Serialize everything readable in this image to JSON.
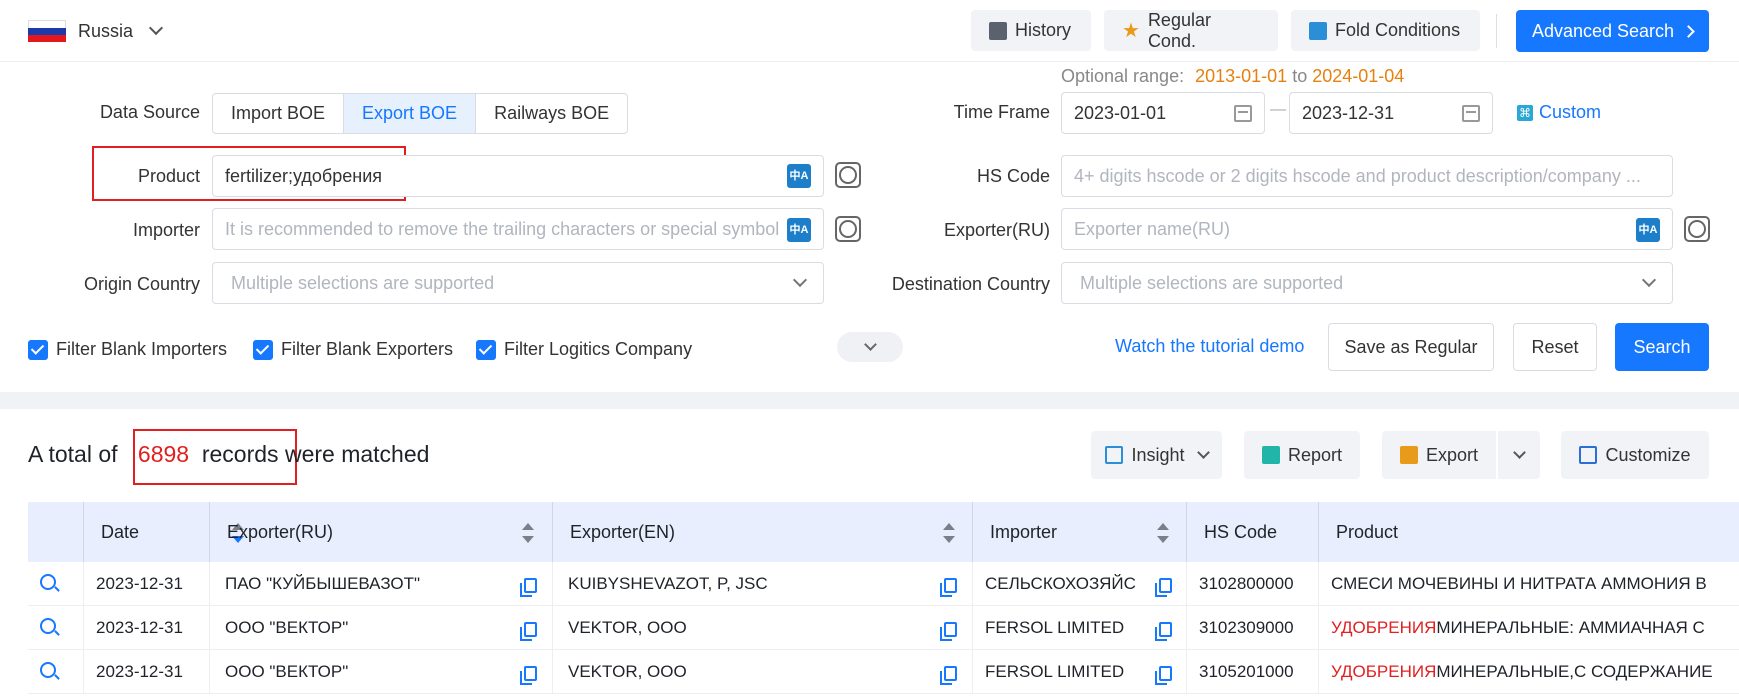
{
  "topbar": {
    "country": "Russia",
    "flag_colors": [
      "#ffffff",
      "#1c3aa9",
      "#e4181c"
    ],
    "history": "History",
    "regular": "Regular Cond.",
    "fold": "Fold Conditions",
    "advanced": "Advanced Search"
  },
  "form": {
    "data_source_label": "Data Source",
    "data_sources": [
      "Import BOE",
      "Export BOE",
      "Railways BOE"
    ],
    "active_source": "Export BOE",
    "optional_prefix": "Optional range:",
    "optional_from": "2013-01-01",
    "optional_to_word": "to",
    "optional_to": "2024-01-04",
    "time_frame_label": "Time Frame",
    "date_from": "2023-01-01",
    "date_to": "2023-12-31",
    "date_dash": "—",
    "custom": "Custom",
    "product_label": "Product",
    "product_value": "fertilizer;удобрения",
    "hs_label": "HS Code",
    "hs_placeholder": "4+ digits hscode or 2 digits hscode and product description/company ...",
    "importer_label": "Importer",
    "importer_placeholder": "It is recommended to remove the trailing characters or special symbols",
    "exporter_label": "Exporter(RU)",
    "exporter_placeholder": "Exporter name(RU)",
    "origin_label": "Origin Country",
    "origin_placeholder": "Multiple selections are supported",
    "dest_label": "Destination Country",
    "dest_placeholder": "Multiple selections are supported",
    "translate_glyph": "中A",
    "checks": [
      "Filter Blank Importers",
      "Filter Blank Exporters",
      "Filter Logitics Company"
    ],
    "tutorial": "Watch the tutorial demo",
    "save_regular": "Save as Regular",
    "reset": "Reset",
    "search": "Search"
  },
  "results": {
    "prefix": "A total of ",
    "count": "6898",
    "records": "  records",
    "suffix": " were matched",
    "insight": "Insight",
    "report": "Report",
    "export": "Export",
    "customize": "Customize"
  },
  "table": {
    "columns": [
      "Date",
      "Exporter(RU)",
      "Exporter(EN)",
      "Importer",
      "HS Code",
      "Product"
    ],
    "rows": [
      {
        "date": "2023-12-31",
        "exporter_ru": "ПАО \"КУЙБЫШЕВАЗОТ\"",
        "exporter_en": "KUIBYSHEVAZOT, P, JSC",
        "importer": "СЕЛЬСКОХОЗЯЙС",
        "hs": "3102800000",
        "product_hl": "",
        "product": "СМЕСИ МОЧЕВИНЫ И НИТРАТА АММОНИЯ В"
      },
      {
        "date": "2023-12-31",
        "exporter_ru": "ООО \"ВЕКТОР\"",
        "exporter_en": "VEKTOR, OOO",
        "importer": "FERSOL LIMITED",
        "hs": "3102309000",
        "product_hl": "УДОБРЕНИЯ",
        "product": " МИНЕРАЛЬНЫЕ: АММИАЧНАЯ С"
      },
      {
        "date": "2023-12-31",
        "exporter_ru": "ООО \"ВЕКТОР\"",
        "exporter_en": "VEKTOR, OOO",
        "importer": "FERSOL LIMITED",
        "hs": "3105201000",
        "product_hl": "УДОБРЕНИЯ",
        "product": " МИНЕРАЛЬНЫЕ,С СОДЕРЖАНИЕ"
      }
    ]
  }
}
